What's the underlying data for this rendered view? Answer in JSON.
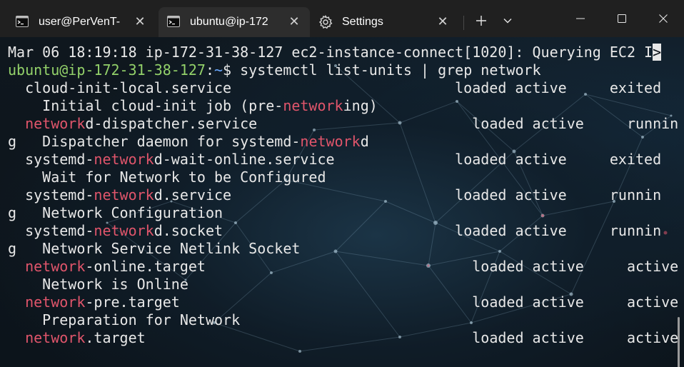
{
  "tabs": [
    {
      "label": "user@PerVenT-",
      "icon": "terminal-icon",
      "active": false
    },
    {
      "label": "ubuntu@ip-172",
      "icon": "terminal-icon",
      "active": true
    },
    {
      "label": "Settings",
      "icon": "gear-icon",
      "active": false
    }
  ],
  "terminal": {
    "lines": [
      [
        {
          "t": "Mar 06 18:19:18 ip-172-31-38-127 ec2-instance-connect[1020]: Querying EC2 I"
        },
        {
          "t": ">",
          "c": "cursor-block"
        }
      ],
      [
        {
          "t": "ubuntu@ip-172-31-38-127",
          "c": "p-user"
        },
        {
          "t": ":"
        },
        {
          "t": "~",
          "c": "p-path"
        },
        {
          "t": "$ systemctl list-units | grep network"
        }
      ],
      [
        {
          "t": "  cloud-init-local.service                          loaded active     exited"
        }
      ],
      [
        {
          "t": "    Initial cloud-init job (pre-"
        },
        {
          "t": "network",
          "c": "hl"
        },
        {
          "t": "ing)"
        }
      ],
      [
        {
          "t": "  "
        },
        {
          "t": "network",
          "c": "hl"
        },
        {
          "t": "d-dispatcher.service                         loaded active     runnin"
        }
      ],
      [
        {
          "t": "g   Dispatcher daemon for systemd-"
        },
        {
          "t": "network",
          "c": "hl"
        },
        {
          "t": "d"
        }
      ],
      [
        {
          "t": "  systemd-"
        },
        {
          "t": "network",
          "c": "hl"
        },
        {
          "t": "d-wait-online.service              loaded active     exited"
        }
      ],
      [
        {
          "t": "    Wait for Network to be Configured"
        }
      ],
      [
        {
          "t": "  systemd-"
        },
        {
          "t": "network",
          "c": "hl"
        },
        {
          "t": "d.service                          loaded active     runnin"
        }
      ],
      [
        {
          "t": "g   Network Configuration"
        }
      ],
      [
        {
          "t": "  systemd-"
        },
        {
          "t": "network",
          "c": "hl"
        },
        {
          "t": "d.socket                           loaded active     runnin"
        }
      ],
      [
        {
          "t": "g   Network Service Netlink Socket"
        }
      ],
      [
        {
          "t": "  "
        },
        {
          "t": "network",
          "c": "hl"
        },
        {
          "t": "-online.target                               loaded active     active"
        }
      ],
      [
        {
          "t": "    Network is Online"
        }
      ],
      [
        {
          "t": "  "
        },
        {
          "t": "network",
          "c": "hl"
        },
        {
          "t": "-pre.target                                  loaded active     active"
        }
      ],
      [
        {
          "t": "    Preparation for Network"
        }
      ],
      [
        {
          "t": "  "
        },
        {
          "t": "network",
          "c": "hl"
        },
        {
          "t": ".target                                      loaded active     active"
        }
      ]
    ]
  },
  "colors": {
    "highlight": "#e0556b",
    "prompt_user": "#93d16a",
    "prompt_path": "#6aa8ff",
    "text": "#e8e8e8"
  }
}
